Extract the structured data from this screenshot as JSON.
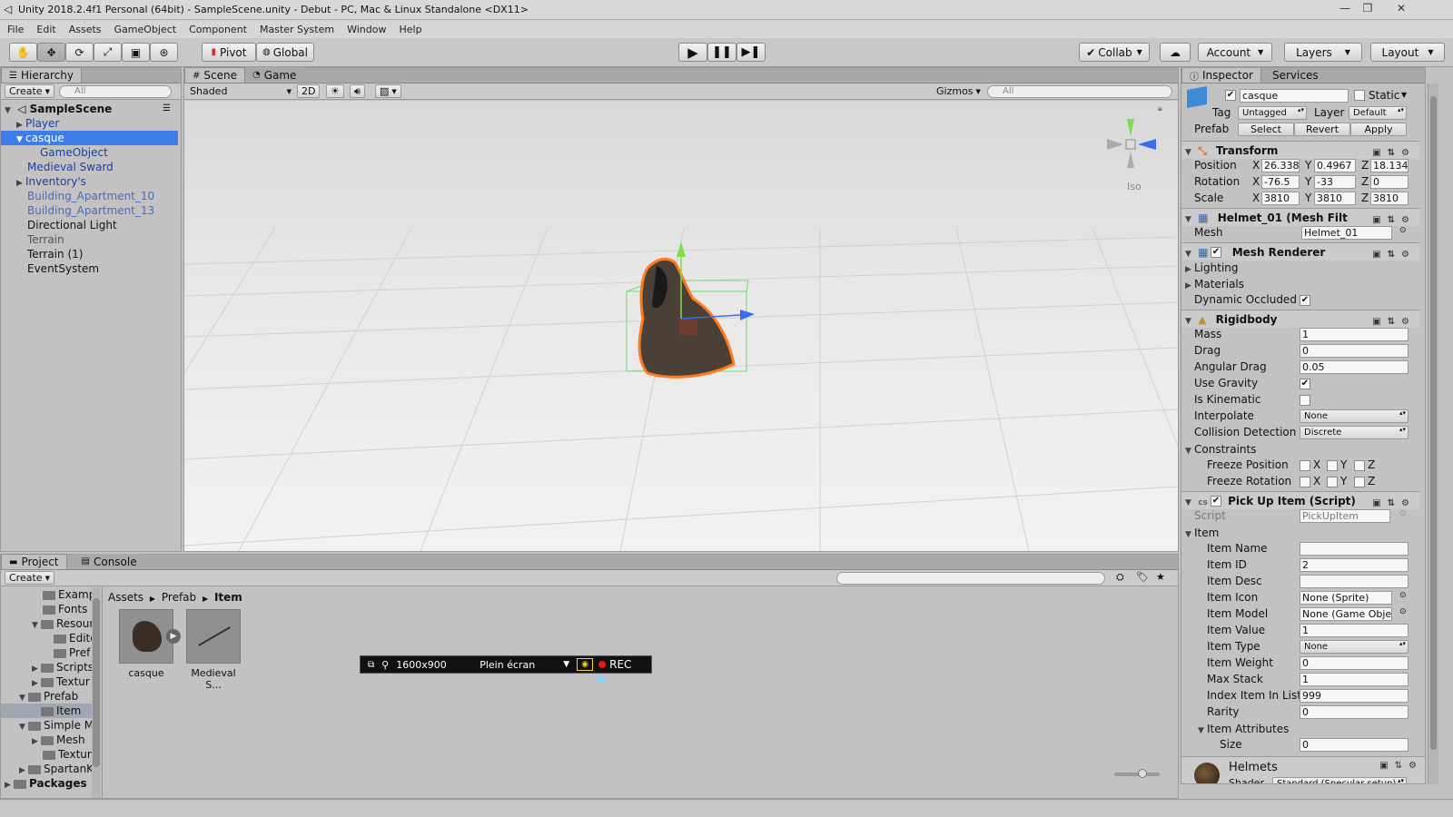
{
  "window": {
    "title": "Unity 2018.2.4f1 Personal (64bit) - SampleScene.unity - Debut - PC, Mac & Linux Standalone <DX11>"
  },
  "menu": [
    "File",
    "Edit",
    "Assets",
    "GameObject",
    "Component",
    "Master System",
    "Window",
    "Help"
  ],
  "toolbar": {
    "pivot": "Pivot",
    "global": "Global",
    "collab": "Collab",
    "account": "Account",
    "layers": "Layers",
    "layout": "Layout"
  },
  "hierarchy": {
    "tab": "Hierarchy",
    "create": "Create",
    "search_placeholder": "All",
    "scene": "SampleScene",
    "items": [
      {
        "label": "Player"
      },
      {
        "label": "casque"
      },
      {
        "label": "GameObject"
      },
      {
        "label": "Medieval Sward"
      },
      {
        "label": "Inventory's"
      },
      {
        "label": "Building_Apartment_10"
      },
      {
        "label": "Building_Apartment_13"
      },
      {
        "label": "Directional Light"
      },
      {
        "label": "Terrain"
      },
      {
        "label": "Terrain (1)"
      },
      {
        "label": "EventSystem"
      }
    ]
  },
  "scene": {
    "tab_scene": "Scene",
    "tab_game": "Game",
    "shading": "Shaded",
    "mode2d": "2D",
    "gizmos": "Gizmos",
    "search_placeholder": "All",
    "gizmo_label": "Iso"
  },
  "inspector": {
    "tab": "Inspector",
    "services_tab": "Services",
    "object_name": "casque",
    "static_label": "Static",
    "tag_label": "Tag",
    "tag_value": "Untagged",
    "layer_label": "Layer",
    "layer_value": "Default",
    "prefab_label": "Prefab",
    "prefab_select": "Select",
    "prefab_revert": "Revert",
    "prefab_apply": "Apply",
    "transform": {
      "title": "Transform",
      "position_label": "Position",
      "rotation_label": "Rotation",
      "scale_label": "Scale",
      "position": [
        "26.338",
        "0.4967",
        "18.134"
      ],
      "rotation": [
        "-76.5",
        "-33",
        "0"
      ],
      "scale": [
        "3810",
        "3810",
        "3810"
      ]
    },
    "meshfilter": {
      "title": "Helmet_01 (Mesh Filt",
      "mesh_label": "Mesh",
      "mesh_value": "Helmet_01"
    },
    "meshrenderer": {
      "title": "Mesh Renderer",
      "lighting": "Lighting",
      "materials": "Materials",
      "dynamic_occluded": "Dynamic Occluded"
    },
    "rigidbody": {
      "title": "Rigidbody",
      "mass_label": "Mass",
      "mass": "1",
      "drag_label": "Drag",
      "drag": "0",
      "angular_label": "Angular Drag",
      "angular": "0.05",
      "gravity_label": "Use Gravity",
      "kinematic_label": "Is Kinematic",
      "interp_label": "Interpolate",
      "interp": "None",
      "collision_label": "Collision Detection",
      "collision": "Discrete",
      "constraints": "Constraints",
      "freeze_pos": "Freeze Position",
      "freeze_rot": "Freeze Rotation"
    },
    "pickup": {
      "title": "Pick Up Item (Script)",
      "script_label": "Script",
      "script_value": "PickUpItem",
      "item_label": "Item",
      "fields": [
        {
          "label": "Item Name",
          "value": ""
        },
        {
          "label": "Item ID",
          "value": "2"
        },
        {
          "label": "Item Desc",
          "value": ""
        },
        {
          "label": "Item Icon",
          "value": "None (Sprite)"
        },
        {
          "label": "Item Model",
          "value": "None (Game Obje"
        },
        {
          "label": "Item Value",
          "value": "1"
        },
        {
          "label": "Item Type",
          "value": "None"
        },
        {
          "label": "Item Weight",
          "value": "0"
        },
        {
          "label": "Max Stack",
          "value": "1"
        },
        {
          "label": "Index Item In List",
          "value": "999"
        },
        {
          "label": "Rarity",
          "value": "0"
        }
      ],
      "attributes_label": "Item Attributes",
      "size_label": "Size",
      "size": "0"
    },
    "material": {
      "name": "Helmets",
      "shader_label": "Shader",
      "shader_value": "Standard (Specular setup)"
    }
  },
  "project": {
    "tab_project": "Project",
    "tab_console": "Console",
    "create": "Create",
    "tree": [
      {
        "label": "Examp",
        "depth": 2
      },
      {
        "label": "Fonts",
        "depth": 2
      },
      {
        "label": "Resour",
        "depth": 2
      },
      {
        "label": "Edito",
        "depth": 3
      },
      {
        "label": "Pref",
        "depth": 3
      },
      {
        "label": "Scripts",
        "depth": 2
      },
      {
        "label": "Textur",
        "depth": 2
      },
      {
        "label": "Prefab",
        "depth": 1
      },
      {
        "label": "Item",
        "depth": 2
      },
      {
        "label": "Simple M",
        "depth": 1
      },
      {
        "label": "Mesh",
        "depth": 2
      },
      {
        "label": "Textur",
        "depth": 2
      },
      {
        "label": "SpartanK",
        "depth": 1
      },
      {
        "label": "Packages",
        "depth": 0
      }
    ],
    "breadcrumb": [
      "Assets",
      "Prefab",
      "Item"
    ],
    "assets": [
      {
        "label": "casque"
      },
      {
        "label": "Medieval S..."
      }
    ]
  },
  "recorder": {
    "resolution": "1600x900",
    "mode": "Plein écran",
    "rec": "REC"
  }
}
